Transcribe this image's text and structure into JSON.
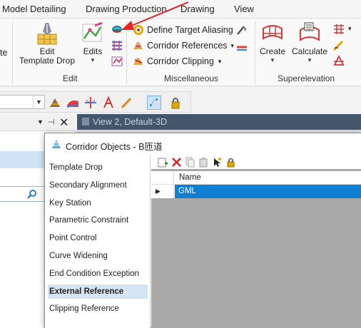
{
  "ribbon_tabs": [
    "Model Detailing",
    "Drawing Production",
    "Drawing",
    "View"
  ],
  "ribbon": {
    "cut_label": "te",
    "edit_group": {
      "template_drop": [
        "Edit",
        "Template Drop"
      ],
      "edits_label": "Edits",
      "group_label": "Edit"
    },
    "misc_group": {
      "items": [
        "Define Target Aliasing",
        "Corridor References",
        "Corridor Clipping"
      ],
      "group_label": "Miscellaneous"
    },
    "super_group": {
      "create_label": "Create",
      "calculate_label": "Calculate",
      "group_label": "Superelevation"
    }
  },
  "view_bar": {
    "title": "View 2, Default-3D"
  },
  "dialog": {
    "title": "Corridor Objects - B匝道",
    "categories": [
      "Template Drop",
      "Secondary Alignment",
      "Key Station",
      "Parametric Constraint",
      "Point Control",
      "Curve Widening",
      "End Condition Exception",
      "External Reference",
      "Clipping Reference"
    ],
    "selected_category": "External Reference",
    "grid": {
      "column": "Name",
      "rows": [
        "GML"
      ]
    }
  },
  "colors": {
    "accent": "#0f7fd6",
    "arrow": "#e8262a",
    "view_bar": "#43566b",
    "selection": "#d5e4f3"
  }
}
